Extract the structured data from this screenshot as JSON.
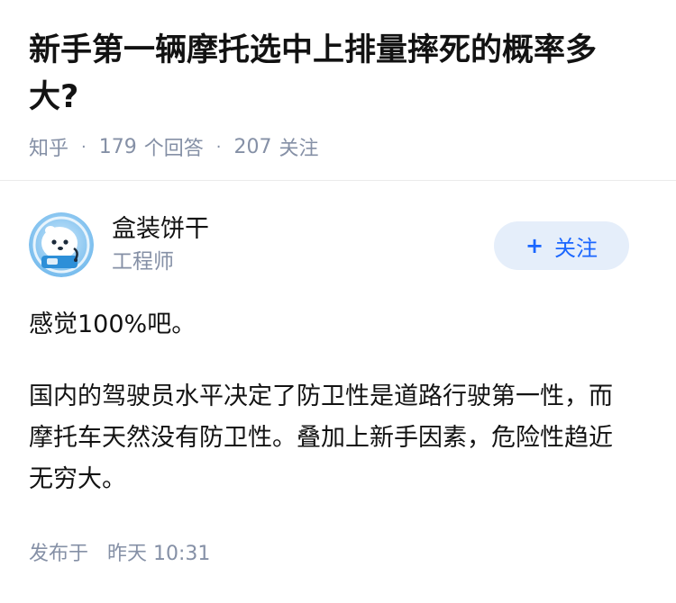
{
  "question": {
    "title": "新手第一辆摩托选中上排量摔死的概率多大?",
    "source": "知乎",
    "answers_count": "179",
    "answers_label": "个回答",
    "followers_count": "207",
    "followers_label": "关注",
    "separator": "·"
  },
  "author": {
    "avatar_icon": "robot-avatar-icon",
    "name": "盒装饼干",
    "title": "工程师",
    "follow_plus": "+",
    "follow_label": "关注"
  },
  "answer": {
    "paragraphs": [
      "感觉100%吧。",
      "国内的驾驶员水平决定了防卫性是道路行驶第一性，而摩托车天然没有防卫性。叠加上新手因素，危险性趋近无穷大。"
    ]
  },
  "footer": {
    "published_label": "发布于",
    "published_time": "昨天 10:31"
  },
  "colors": {
    "accent": "#1a66ff",
    "muted": "#8590a6",
    "follow_bg": "#e5eefa"
  }
}
